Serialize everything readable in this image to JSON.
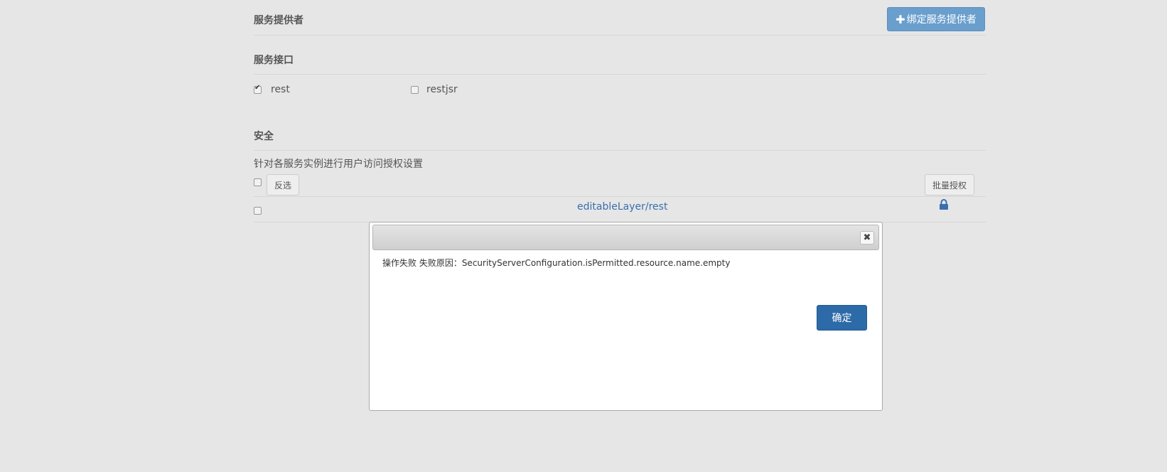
{
  "providers": {
    "title": "服务提供者",
    "bind_button": "绑定服务提供者",
    "bind_icon": "plus-icon"
  },
  "interfaces": {
    "title": "服务接口",
    "options": [
      {
        "label": "rest",
        "checked": true
      },
      {
        "label": "restjsr",
        "checked": false
      }
    ]
  },
  "security": {
    "title": "安全",
    "description": "针对各服务实例进行用户访问授权设置",
    "invert_button": "反选",
    "batch_button": "批量授权",
    "rows": [
      {
        "name": "editableLayer/rest",
        "checked": false,
        "icon": "lock-icon"
      }
    ]
  },
  "dialog": {
    "title": "",
    "close_symbol": "✖",
    "message": "操作失败 失败原因：SecurityServerConfiguration.isPermitted.resource.name.empty",
    "ok_button": "确定"
  },
  "colors": {
    "background": "#e6e6e6",
    "primary": "#2d6aa8",
    "bind_button": "#6a9fcd",
    "link": "#3a6fae"
  }
}
